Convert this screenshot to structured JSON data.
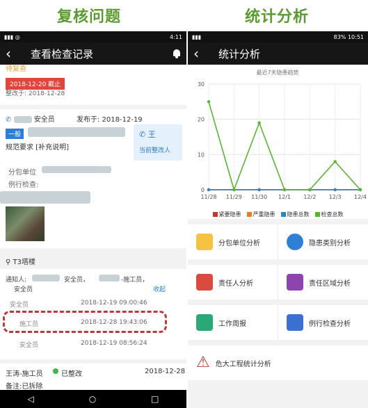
{
  "captions": {
    "left": "复核问题",
    "right": "统计分析"
  },
  "left_screen": {
    "status": {
      "time": "4:11"
    },
    "title": "查看检查记录",
    "pending": "待复查",
    "deadline": "2018-12-20 截止",
    "rectified_time": "整改于: 2018-12-28",
    "publisher_role": "安全员",
    "published": "发布于: 2018-12-19",
    "tag": "一般",
    "rectifier_name": "王",
    "rectifier_role": "当前整改人",
    "spec": "规范要求 [补充说明]",
    "subcontractor_label": "分包单位",
    "inspection_label": "例行检查:",
    "location": "T3塔楼",
    "notice_label": "通知人:",
    "notice_text": "安全员，",
    "notice_text2": "-施工员，",
    "notice_text3": "安全员",
    "collapse": "收起",
    "records": [
      {
        "role": "安全员",
        "time": "2018-12-19 09:00:46"
      },
      {
        "role": "施工员",
        "time": "2018-12-28 19:43:06"
      },
      {
        "role": "安全员",
        "time": "2018-12-19 08:56:24"
      }
    ],
    "last_record": {
      "name": "王涛-施工员",
      "status": "已整改",
      "date": "2018-12-28"
    },
    "remark": "备注:已拆除"
  },
  "right_screen": {
    "status": {
      "battery": "83%",
      "time": "10:51"
    },
    "title": "统计分析",
    "chart_data": {
      "type": "line",
      "title": "最近7天隐患趋势",
      "x": [
        "11/28",
        "11/29",
        "11/30",
        "12/1",
        "12/2",
        "12/3",
        "12/4"
      ],
      "ylim": [
        0,
        30
      ],
      "yticks": [
        0,
        10,
        20,
        30
      ],
      "series": [
        {
          "name": "紧要隐患",
          "color": "#c0392b",
          "values": [
            0,
            0,
            0,
            0,
            0,
            0,
            0
          ]
        },
        {
          "name": "严重隐患",
          "color": "#e67e22",
          "values": [
            0,
            0,
            0,
            0,
            0,
            0,
            0
          ]
        },
        {
          "name": "隐患总数",
          "color": "#2e86c1",
          "values": [
            0,
            0,
            0,
            0,
            0,
            0,
            0
          ]
        },
        {
          "name": "检查总数",
          "color": "#58b530",
          "values": [
            25,
            0,
            19,
            0,
            0,
            8,
            0
          ]
        }
      ]
    },
    "menu": [
      [
        "分包单位分析",
        "隐患类别分析"
      ],
      [
        "责任人分析",
        "责任区域分析"
      ],
      [
        "工作周报",
        "例行检查分析"
      ],
      [
        "危大工程统计分析"
      ]
    ]
  }
}
